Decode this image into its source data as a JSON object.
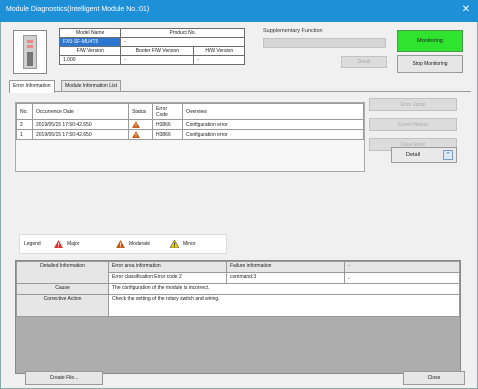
{
  "window": {
    "title": "Module Diagnostics(Intelligent Module No.:01)",
    "close_glyph": "✕"
  },
  "module_info": {
    "model_name_label": "Model Name",
    "product_no_label": "Product No.",
    "model_name": "FX5-SF-MU4T5",
    "product_no": "-",
    "fw_version_label": "F/W Version",
    "booter_fw_label": "Booter F/W Version",
    "hw_version_label": "H/W Version",
    "fw_version": "1.000",
    "booter_fw": "-",
    "hw_version": "-"
  },
  "supplementary": {
    "label": "Supplementary Function",
    "detail_button": "Detail"
  },
  "monitoring": {
    "start_label": "Monitoring",
    "start_color": "#2fe32f",
    "stop_label": "Stop Monitoring"
  },
  "tabs": [
    {
      "label": "Error Information",
      "active": true
    },
    {
      "label": "Module Information List",
      "active": false
    }
  ],
  "error_table": {
    "headers": [
      "No.",
      "Occurrence Date",
      "Status",
      "Error Code",
      "Overview"
    ],
    "rows": [
      {
        "no": "2",
        "date": "2019/05/15 17:50:42.650",
        "status": "moderate",
        "code": "H3866",
        "overview": "Configuration error"
      },
      {
        "no": "1",
        "date": "2019/05/15 17:50:42.650",
        "status": "moderate",
        "code": "H3866",
        "overview": "Configuration error"
      }
    ]
  },
  "side_buttons": {
    "error_jump": "Error Jump",
    "event_history": "Event History",
    "clear_error": "Clear Error"
  },
  "detail_button": {
    "label": "Detail",
    "icon": "chevron-up-icon"
  },
  "legend": {
    "label": "Legend",
    "major": "Major",
    "moderate": "Moderate",
    "minor": "Minor",
    "colors": {
      "major": "#e03030",
      "moderate": "#c85a14",
      "minor": "#f0d000"
    }
  },
  "detail_info": {
    "detailed_label": "Detailed Information",
    "error_area_header": "Error area information",
    "failure_header": "Failure information",
    "extra_header": "-",
    "error_area_value": "Error classification:Error code 2",
    "failure_value": "command:3",
    "extra_value": "-",
    "cause_label": "Cause",
    "cause_value": "The configuration of the module is incorrect.",
    "action_label": "Corrective Action",
    "action_value": "Check the setting of the rotary switch and wiring."
  },
  "footer": {
    "create_file": "Create File...",
    "close": "Close"
  }
}
